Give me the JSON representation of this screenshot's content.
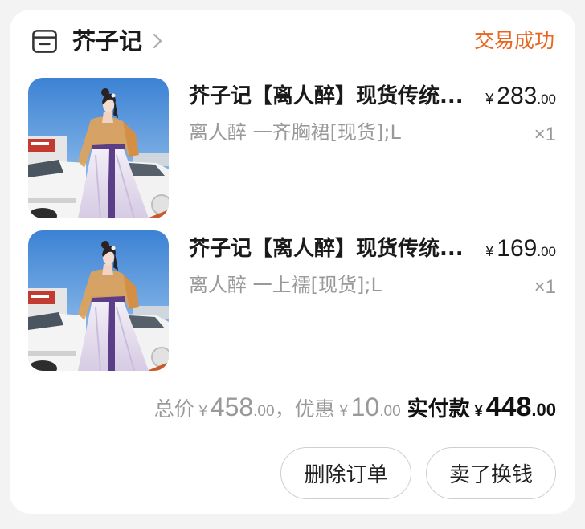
{
  "shop": {
    "name": "芥子记",
    "status": "交易成功",
    "icon": "store-icon",
    "link_icon": "chevron-right-icon"
  },
  "items": [
    {
      "title": "芥子记【离人醉】现货传统...",
      "price": {
        "currency": "¥",
        "integer": "283",
        "decimal": ".00"
      },
      "variant": "离人醉 一齐胸裙[现货];L",
      "quantity": "×1"
    },
    {
      "title": "芥子记【离人醉】现货传统...",
      "price": {
        "currency": "¥",
        "integer": "169",
        "decimal": ".00"
      },
      "variant": "离人醉 一上襦[现货];L",
      "quantity": "×1"
    }
  ],
  "summary": {
    "total_label": "总价",
    "total": {
      "currency": "¥",
      "integer": "458",
      "decimal": ".00"
    },
    "separator": "，",
    "discount_label": "优惠",
    "discount": {
      "currency": "¥",
      "integer": "10",
      "decimal": ".00"
    },
    "paid_label": "实付款",
    "paid": {
      "currency": "¥",
      "integer": "448",
      "decimal": ".00"
    }
  },
  "actions": {
    "delete_order": "删除订单",
    "resell": "卖了换钱"
  },
  "colors": {
    "accent": "#e8661e",
    "text": "#1a1a1a",
    "muted": "#999999",
    "card": "#ffffff",
    "background": "#f3f3f3",
    "button_border": "#cfcfcf"
  }
}
